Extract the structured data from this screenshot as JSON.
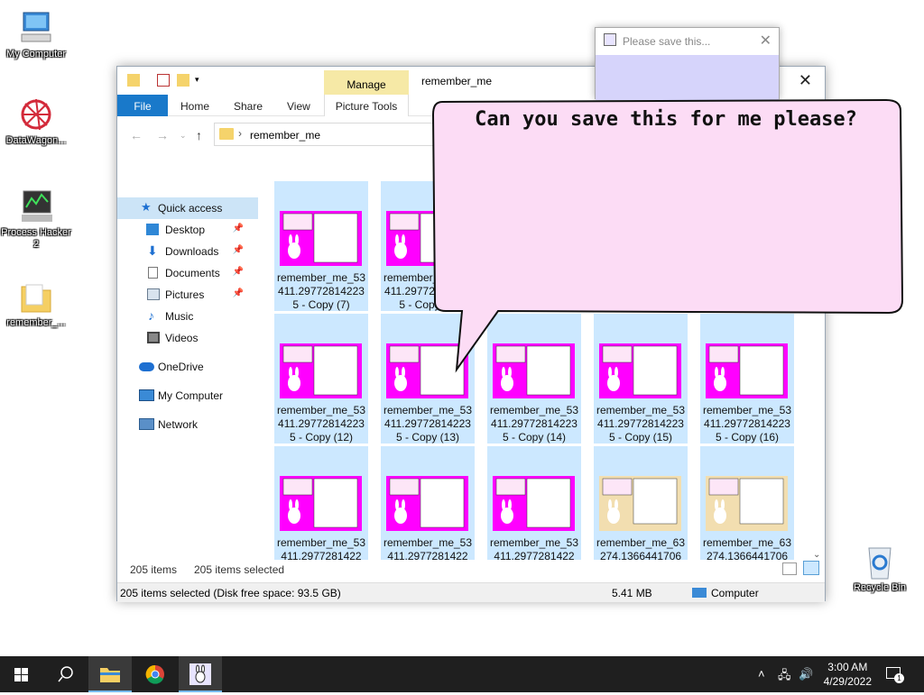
{
  "desktop": {
    "icons": [
      {
        "label": "My Computer"
      },
      {
        "label": "DataWagon..."
      },
      {
        "label": "Process Hacker 2"
      },
      {
        "label": "remember_..."
      },
      {
        "label": "Recycle Bin"
      }
    ]
  },
  "explorer": {
    "window_title": "remember_me",
    "contextual_tab": "Manage",
    "ribbon_tabs": [
      "File",
      "Home",
      "Share",
      "View",
      "Picture Tools"
    ],
    "address": "remember_me",
    "nav_items": [
      {
        "label": "Quick access"
      },
      {
        "label": "Desktop"
      },
      {
        "label": "Downloads"
      },
      {
        "label": "Documents"
      },
      {
        "label": "Pictures"
      },
      {
        "label": "Music"
      },
      {
        "label": "Videos"
      },
      {
        "label": "OneDrive"
      },
      {
        "label": "My Computer"
      },
      {
        "label": "Network"
      }
    ],
    "files": [
      {
        "name": "remember_me_53411.297728142235 - Copy (7)"
      },
      {
        "name": "remember_me_53411.297728142235 - Copy (8)"
      },
      {
        "name": "remember_me_53411.297728142235 - Copy (12)"
      },
      {
        "name": "remember_me_53411.297728142235 - Copy (13)"
      },
      {
        "name": "remember_me_53411.297728142235 - Copy (14)"
      },
      {
        "name": "remember_me_53411.297728142235 - Copy (15)"
      },
      {
        "name": "remember_me_53411.297728142235 - Copy (16)"
      },
      {
        "name": "remember_me_53411.2977281422"
      },
      {
        "name": "remember_me_53411.2977281422"
      },
      {
        "name": "remember_me_53411.2977281422"
      },
      {
        "name": "remember_me_63274.1366441706"
      },
      {
        "name": "remember_me_63274.1366441706"
      }
    ],
    "count_label": "205 items",
    "selected_label": "205 items selected",
    "status_left": "205 items selected (Disk free space: 93.5 GB)",
    "status_size": "5.41 MB",
    "status_location": "Computer"
  },
  "popup": {
    "title": "Please save this..."
  },
  "bubble": {
    "text": "Can you save this for me please?"
  },
  "taskbar": {
    "time": "3:00 AM",
    "date": "4/29/2022",
    "notification_count": "1"
  },
  "colors": {
    "accent": "#1979ca",
    "selection": "#cce8ff",
    "bubble_fill": "#fcdcf5",
    "manage_tab": "#f6e9a6",
    "thumb_magenta": "#ff00ff"
  }
}
